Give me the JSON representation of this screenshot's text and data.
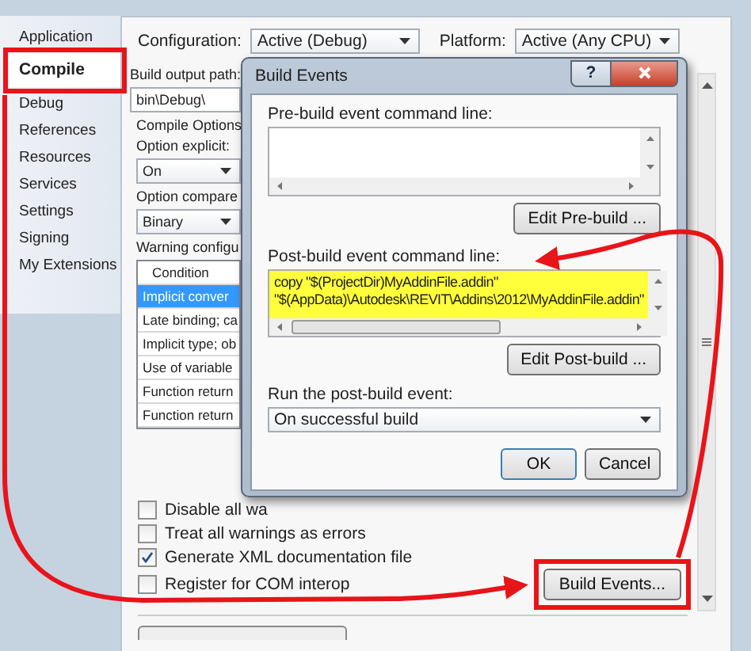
{
  "sidebar": {
    "items": [
      {
        "label": "Application",
        "selected": false
      },
      {
        "label": "Compile",
        "selected": true
      },
      {
        "label": "Debug",
        "selected": false
      },
      {
        "label": "References",
        "selected": false
      },
      {
        "label": "Resources",
        "selected": false
      },
      {
        "label": "Services",
        "selected": false
      },
      {
        "label": "Settings",
        "selected": false
      },
      {
        "label": "Signing",
        "selected": false
      },
      {
        "label": "My Extensions",
        "selected": false
      }
    ]
  },
  "config": {
    "configuration_label": "Configuration:",
    "configuration": "Active (Debug)",
    "platform_label": "Platform:",
    "platform": "Active (Any CPU)"
  },
  "compile": {
    "build_output_label": "Build output path:",
    "build_output_path": "bin\\Debug\\",
    "options_title": "Compile Options",
    "option_explicit_label": "Option explicit:",
    "option_explicit": "On",
    "option_compare_label": "Option compare",
    "option_compare": "Binary",
    "warning_label": "Warning configu",
    "warnings": {
      "column": "Condition",
      "rows": [
        {
          "condition": "Implicit conver",
          "selected": true
        },
        {
          "condition": "Late binding; ca",
          "selected": false
        },
        {
          "condition": "Implicit type; ob",
          "selected": false
        },
        {
          "condition": "Use of variable",
          "selected": false
        },
        {
          "condition": "Function return",
          "selected": false
        },
        {
          "condition": "Function return",
          "selected": false
        }
      ]
    },
    "checkboxes": [
      {
        "label": "Disable all wa",
        "checked": false
      },
      {
        "label": "Treat all warnings as errors",
        "checked": false
      },
      {
        "label": "Generate XML documentation file",
        "checked": true
      },
      {
        "label": "Register for COM interop",
        "checked": false
      }
    ],
    "build_events_button": "Build Events..."
  },
  "dialog": {
    "title": "Build Events",
    "help": "?",
    "pre_build_label": "Pre-build event command line:",
    "edit_pre_build": "Edit Pre-build ...",
    "post_build_label": "Post-build event command line:",
    "post_build": "copy \"$(ProjectDir)MyAddinFile.addin\"\n\"$(AppData)\\Autodesk\\REVIT\\Addins\\2012\\MyAddinFile.addin\"",
    "edit_post_build": "Edit Post-build ...",
    "run_label": "Run the post-build event:",
    "run_when": "On successful build",
    "ok": "OK",
    "cancel": "Cancel"
  }
}
